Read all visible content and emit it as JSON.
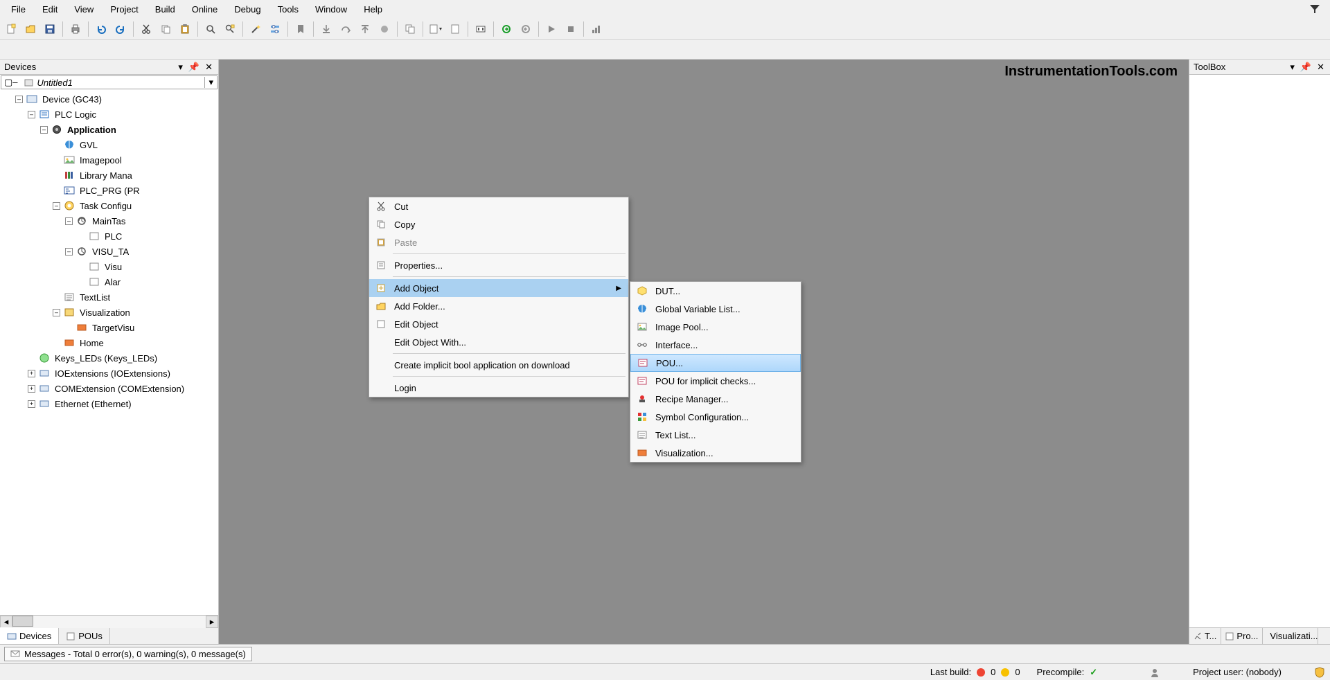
{
  "menubar": [
    "File",
    "Edit",
    "View",
    "Project",
    "Build",
    "Online",
    "Debug",
    "Tools",
    "Window",
    "Help"
  ],
  "panels": {
    "devices_title": "Devices",
    "toolbox_title": "ToolBox"
  },
  "tree": {
    "project": "Untitled1",
    "device": "Device (GC43)",
    "plc_logic": "PLC Logic",
    "application": "Application",
    "gvl": "GVL",
    "imagepool": "Imagepool",
    "library_manager": "Library Mana",
    "plc_prg": "PLC_PRG (PR",
    "task_config": "Task Configu",
    "main_task": "MainTas",
    "plc_task_item": "PLC",
    "visu_task": "VISU_TA",
    "visu_item": "Visu",
    "alarm_item": "Alar",
    "textlist": "TextList",
    "visualization_mgr": "Visualization",
    "target_visu": "TargetVisu",
    "home": "Home",
    "keys_leds": "Keys_LEDs (Keys_LEDs)",
    "io_ext": "IOExtensions (IOExtensions)",
    "com_ext": "COMExtension (COMExtension)",
    "ethernet": "Ethernet (Ethernet)"
  },
  "left_tabs": {
    "devices": "Devices",
    "pous": "POUs"
  },
  "watermark": "InstrumentationTools.com",
  "context_menu": {
    "cut": "Cut",
    "copy": "Copy",
    "paste": "Paste",
    "properties": "Properties...",
    "add_object": "Add Object",
    "add_folder": "Add Folder...",
    "edit_object": "Edit Object",
    "edit_object_with": "Edit Object With...",
    "create_implicit": "Create implicit bool application on download",
    "login": "Login"
  },
  "submenu": {
    "dut": "DUT...",
    "gvl": "Global Variable List...",
    "image_pool": "Image Pool...",
    "interface": "Interface...",
    "pou": "POU...",
    "pou_implicit": "POU for implicit checks...",
    "recipe_manager": "Recipe Manager...",
    "symbol_config": "Symbol Configuration...",
    "text_list": "Text List...",
    "visualization": "Visualization..."
  },
  "right_tabs": {
    "t1": "T...",
    "t2": "Pro...",
    "t3": "Visualizati..."
  },
  "messages_bar": "Messages - Total 0 error(s), 0 warning(s), 0 message(s)",
  "status": {
    "last_build_label": "Last build:",
    "errors": "0",
    "warnings": "0",
    "precompile_label": "Precompile:",
    "precompile_ok": "✓",
    "project_user": "Project user: (nobody)"
  }
}
